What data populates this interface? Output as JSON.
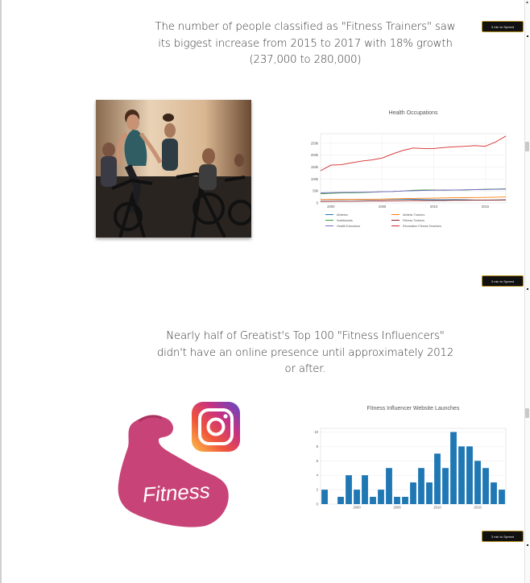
{
  "stats": {
    "fitness_trainers_text": "The number of people classified as \"Fitness Trainers\" saw its biggest increase from 2015 to 2017 with 18% growth (237,000 to 280,000)",
    "influencers_text": "Nearly half of Greatist's Top 100 \"Fitness Influencers\" didn't have an online presence until approximately 2012 or after."
  },
  "spreed_badge": {
    "label": "3 min to Spreed"
  },
  "logo": {
    "arm_text": "Fitness"
  },
  "colors": {
    "line_red": "#d62728",
    "bar_blue": "#1f77b4",
    "badge_border": "#b58b1b",
    "arm_pink": "#c84377"
  },
  "chart_data": [
    {
      "type": "line",
      "title": "Health Occupations",
      "x": [
        1999,
        2000,
        2001,
        2002,
        2003,
        2004,
        2005,
        2006,
        2007,
        2008,
        2009,
        2010,
        2011,
        2012,
        2013,
        2014,
        2015,
        2016,
        2017
      ],
      "xticks": [
        "2000",
        "2005",
        "2010",
        "2015"
      ],
      "yticks": [
        "0",
        "50k",
        "100k",
        "150k",
        "200k",
        "250k"
      ],
      "ylim": [
        0,
        290000
      ],
      "legend_position": "bottom",
      "series": [
        {
          "name": "Athletes",
          "color": "#1f77b4",
          "values": [
            13000,
            14000,
            14000,
            14500,
            14000,
            14000,
            15000,
            15000,
            15500,
            15500,
            14000,
            13000,
            13000,
            13500,
            13000,
            12000,
            12000,
            12500,
            13000
          ]
        },
        {
          "name": "Athletic Trainers",
          "color": "#ff7f0e",
          "values": [
            14000,
            14500,
            15000,
            15000,
            15500,
            15500,
            16000,
            17000,
            18000,
            19000,
            19500,
            20000,
            21000,
            21500,
            22000,
            22500,
            23000,
            24000,
            25000
          ]
        },
        {
          "name": "Nutritionists",
          "color": "#2ca02c",
          "values": [
            38000,
            40000,
            42000,
            42500,
            43000,
            45000,
            47000,
            48000,
            50000,
            53000,
            54000,
            54000,
            53000,
            53500,
            54000,
            56000,
            57000,
            58000,
            59000
          ]
        },
        {
          "name": "Fitness Trainers",
          "color": "#8b1a1a",
          "values": [
            6000,
            6500,
            7000,
            7000,
            7500,
            8000,
            8500,
            9000,
            9500,
            10000,
            10000,
            10500,
            10500,
            11000,
            11000,
            11500,
            12000,
            12000,
            12500
          ]
        },
        {
          "name": "Health Educators",
          "color": "#7b68c8",
          "values": [
            42000,
            43000,
            44000,
            44500,
            45000,
            46000,
            47000,
            48000,
            50000,
            51000,
            52000,
            53000,
            54000,
            54000,
            55000,
            55500,
            56000,
            57000,
            58000
          ]
        },
        {
          "name": "Recreation Fitness Teachers",
          "color": "#d62728",
          "values": [
            135000,
            158000,
            160000,
            168000,
            175000,
            180000,
            188000,
            205000,
            220000,
            230000,
            228000,
            228000,
            232000,
            235000,
            237000,
            240000,
            237000,
            255000,
            280000
          ]
        }
      ]
    },
    {
      "type": "bar",
      "title": "Fitness Influencer Website Launches",
      "x": [
        1996,
        1997,
        1998,
        1999,
        2000,
        2001,
        2002,
        2003,
        2004,
        2005,
        2006,
        2007,
        2008,
        2009,
        2010,
        2011,
        2012,
        2013,
        2014,
        2015,
        2016,
        2017,
        2018
      ],
      "values": [
        2,
        0,
        1,
        4,
        2,
        4,
        1,
        2,
        5,
        1,
        1,
        3,
        5,
        3,
        7,
        5,
        10,
        8,
        8,
        6,
        5,
        3,
        2
      ],
      "xticks": [
        "2000",
        "2005",
        "2010",
        "2015"
      ],
      "yticks": [
        "0",
        "2",
        "4",
        "6",
        "8",
        "10"
      ],
      "ylim": [
        0,
        10.5
      ],
      "color": "#1f77b4"
    }
  ]
}
